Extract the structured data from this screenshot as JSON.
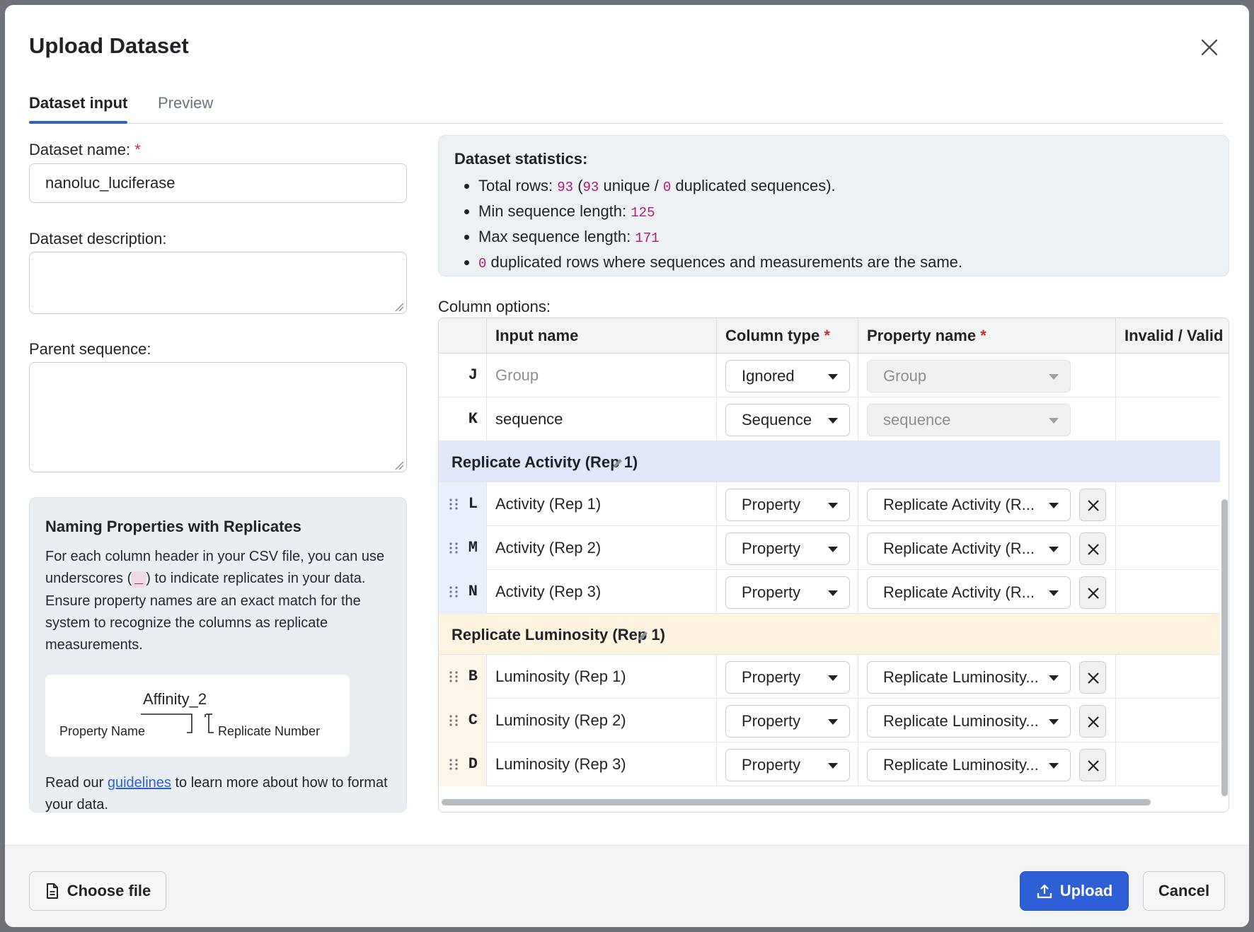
{
  "modal": {
    "title": "Upload Dataset",
    "tabs": [
      {
        "label": "Dataset input",
        "active": true
      },
      {
        "label": "Preview",
        "active": false
      }
    ]
  },
  "form": {
    "name_label": "Dataset name:",
    "required_mark": "*",
    "name_value": "nanoluc_luciferase",
    "description_label": "Dataset description:",
    "description_value": "",
    "parent_label": "Parent sequence:",
    "parent_value": ""
  },
  "info": {
    "title": "Naming Properties with Replicates",
    "body_part1": "For each column header in your CSV file, you can use underscores (",
    "body_code": "_",
    "body_part2": ") to indicate replicates in your data. Ensure property names are an exact match for the system to recognize the columns as replicate measurements.",
    "diagram_word": "Affinity_2",
    "diagram_left": "Property Name",
    "diagram_right": "Replicate Number",
    "footer_pre": "Read our ",
    "footer_link": "guidelines",
    "footer_post": " to learn more about how to format your data."
  },
  "stats": {
    "title": "Dataset statistics:",
    "total_rows_pre": "Total rows: ",
    "total_rows": "93",
    "unique_open": " (",
    "unique": "93",
    "unique_label": " unique / ",
    "duplicated": "0",
    "duplicated_label": " duplicated sequences).",
    "min_label": "Min sequence length: ",
    "min": "125",
    "max_label": "Max sequence length: ",
    "max": "171",
    "dup_rows": "0",
    "dup_rows_label": " duplicated rows where sequences and measurements are the same."
  },
  "columns": {
    "label": "Column options:",
    "headers": {
      "input_name": "Input name",
      "column_type": "Column type",
      "property_name": "Property name",
      "validity": "Invalid / Valid"
    },
    "plain_rows": [
      {
        "letter": "J",
        "name": "Group",
        "type": "Ignored",
        "property": "Group"
      },
      {
        "letter": "K",
        "name": "sequence",
        "type": "Sequence",
        "property": "sequence"
      }
    ],
    "groups": [
      {
        "title": "Replicate Activity (Rep 1)",
        "rows": [
          {
            "letter": "L",
            "name": "Activity (Rep 1)",
            "type": "Property",
            "property": "Replicate Activity (R..."
          },
          {
            "letter": "M",
            "name": "Activity (Rep 2)",
            "type": "Property",
            "property": "Replicate Activity (R..."
          },
          {
            "letter": "N",
            "name": "Activity (Rep 3)",
            "type": "Property",
            "property": "Replicate Activity (R..."
          }
        ]
      },
      {
        "title": "Replicate Luminosity (Rep 1)",
        "rows": [
          {
            "letter": "B",
            "name": "Luminosity (Rep 1)",
            "type": "Property",
            "property": "Replicate Luminosity..."
          },
          {
            "letter": "C",
            "name": "Luminosity (Rep 2)",
            "type": "Property",
            "property": "Replicate Luminosity..."
          },
          {
            "letter": "D",
            "name": "Luminosity (Rep 3)",
            "type": "Property",
            "property": "Replicate Luminosity..."
          }
        ]
      }
    ]
  },
  "footer": {
    "choose_file": "Choose file",
    "upload": "Upload",
    "cancel": "Cancel"
  },
  "colors": {
    "accent": "#2f5fd7",
    "required": "#c4302b",
    "activity_group_bg": "#dfe7f8",
    "luminosity_group_bg": "#fdf3df",
    "numeric_highlight": "#b0197a"
  },
  "icons": {
    "close": "close-icon",
    "drag": "drag-handle-icon",
    "edit": "pencil-icon",
    "remove": "close-x-icon",
    "file": "document-icon",
    "upload": "upload-icon"
  }
}
